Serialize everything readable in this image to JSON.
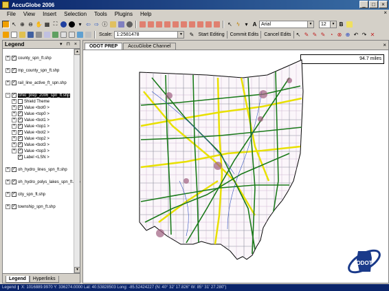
{
  "window": {
    "title": "AccuGlobe 2006"
  },
  "menu": [
    "File",
    "View",
    "Insert",
    "Selection",
    "Tools",
    "Plugins",
    "Help"
  ],
  "toolbar": {
    "font_name": "Arial",
    "font_size": "12",
    "scale_label": "Scale:",
    "scale_value": "1:2581478",
    "start_editing": "Start Editing",
    "commit_edits": "Commit Edits",
    "cancel_edits": "Cancel Edits"
  },
  "legend": {
    "title": "Legend",
    "controls": "▾ ⊓ ×",
    "layers": [
      {
        "label": "county_spn_ft.shp"
      },
      {
        "label": "mp_county_spn_ft.shp"
      },
      {
        "label": "rail_line_active_ft_spn.shp"
      },
      {
        "label": "ohio_prep_2006_spn_ft.shp"
      },
      {
        "label": "oh_hydro_lines_spn_ft.shp"
      },
      {
        "label": "oh_hydro_polys_lakes_spn_ft.shp"
      },
      {
        "label": "city_spn_ft.shp"
      },
      {
        "label": "township_spn_ft.shp"
      }
    ],
    "sublayers": [
      "Shield Theme",
      "Value <bot0 >",
      "Value <top0 >",
      "Value <bot1 >",
      "Value <top1 >",
      "Value <bot2 >",
      "Value <top2 >",
      "Value <bot3 >",
      "Value <top3 >",
      "Label <LSN >"
    ],
    "tabs": [
      "Legend",
      "Hyperlinks"
    ]
  },
  "map": {
    "tabs": [
      "ODOT PREP",
      "AccuGlobe Channel"
    ],
    "scale_text": "94.7 miles",
    "logo_text": "ODOT"
  },
  "status": {
    "left": "Legend",
    "coords": "X: 1016889.9970  Y: 336274.0000  Lat: 40.53828503  Long: -85.52424227  (N: 40° 32' 17.826\"  W: 85° 31' 27.280\")"
  },
  "colors": {
    "title_gradient_start": "#0a246a",
    "highways": "#1a7a1a",
    "interstates": "#e8e000",
    "county_lines": "#6a6a6a"
  }
}
